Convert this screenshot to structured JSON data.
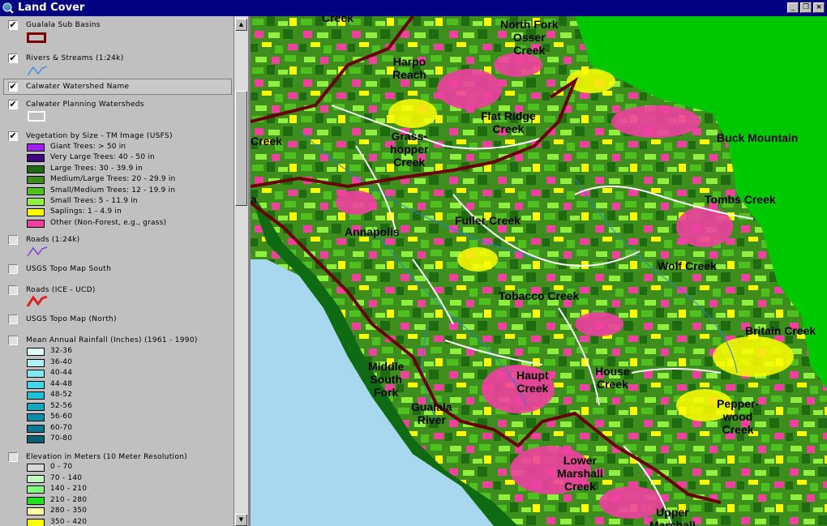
{
  "window": {
    "title": "Land Cover",
    "min_label": "_",
    "restore_label": "❐",
    "close_label": "×"
  },
  "scrollbar": {
    "up": "▲",
    "down": "▼"
  },
  "layers": {
    "sub_basins": {
      "name": "Gualala Sub Basins",
      "checked": "✔",
      "swatch_color": "#7a0000"
    },
    "rivers": {
      "name": "Rivers & Streams (1:24k)",
      "checked": "✔",
      "line_color": "#4a90e2"
    },
    "calwater_name": {
      "name": "Calwater Watershed Name",
      "checked": "✔"
    },
    "calwater_planning": {
      "name": "Calwater Planning Watersheds",
      "checked": "✔"
    },
    "vegetation": {
      "name": "Vegetation by Size - TM Image (USFS)",
      "checked": "✔",
      "classes": [
        {
          "label": "Giant Trees: > 50 in",
          "color": "#a020f0"
        },
        {
          "label": "Very Large Trees: 40 - 50 in",
          "color": "#400080"
        },
        {
          "label": "Large Trees: 30 - 39.9 in",
          "color": "#1e6b10"
        },
        {
          "label": "Medium/Large Trees: 20 - 29.9 in",
          "color": "#3c8c1c"
        },
        {
          "label": "Small/Medium Trees: 12 - 19.9 in",
          "color": "#50c020"
        },
        {
          "label": "Small Trees: 5 - 11.9 in",
          "color": "#90f040"
        },
        {
          "label": "Saplings: 1 - 4.9 in",
          "color": "#ffff00"
        },
        {
          "label": "Other (Non-Forest, e.g., grass)",
          "color": "#f040a0"
        }
      ]
    },
    "roads_24k": {
      "name": "Roads (1:24k)",
      "line_color": "#8040e0"
    },
    "topo_south": {
      "name": "USGS Topo Map South"
    },
    "roads_ice": {
      "name": "Roads (ICE - UCD)",
      "line_color": "#e02020"
    },
    "topo_north": {
      "name": "USGS Topo Map (North)"
    },
    "rainfall": {
      "name": "Mean Annual Rainfall (Inches) (1961 - 1990)",
      "classes": [
        {
          "label": "32-36",
          "color": "#e0ffff"
        },
        {
          "label": "36-40",
          "color": "#b0f0f8"
        },
        {
          "label": "40-44",
          "color": "#80e8f0"
        },
        {
          "label": "44-48",
          "color": "#40d8e8"
        },
        {
          "label": "48-52",
          "color": "#20c0d8"
        },
        {
          "label": "52-56",
          "color": "#10a8c0"
        },
        {
          "label": "56-60",
          "color": "#0890a8"
        },
        {
          "label": "60-70",
          "color": "#087890"
        },
        {
          "label": "70-80",
          "color": "#066070"
        }
      ]
    },
    "elevation": {
      "name": "Elevation in Meters (10 Meter Resolution)",
      "classes": [
        {
          "label": "0 - 70",
          "color": "#d8d8d8"
        },
        {
          "label": "70 - 140",
          "color": "#c0ffc0"
        },
        {
          "label": "140 - 210",
          "color": "#80ff80"
        },
        {
          "label": "210 - 280",
          "color": "#20e020"
        },
        {
          "label": "280 - 350",
          "color": "#ffffa0"
        },
        {
          "label": "350 - 420",
          "color": "#ffff00"
        }
      ]
    }
  },
  "map": {
    "labels": [
      {
        "text": "Creek"
      },
      {
        "text": "North Fork\nOsser\nCreek"
      },
      {
        "text": "Harpo\nReach"
      },
      {
        "text": "Flat Ridge\nCreek"
      },
      {
        "text": "Grass-\nhopper\nCreek"
      },
      {
        "text": "Creek"
      },
      {
        "text": "Buck Mountain"
      },
      {
        "text": "Tombs Creek"
      },
      {
        "text": "Fuller Creek"
      },
      {
        "text": "Annapolis"
      },
      {
        "text": "Wolf Creek"
      },
      {
        "text": "Tobacco Creek"
      },
      {
        "text": "Britain Creek"
      },
      {
        "text": "Middle\nSouth\nFork"
      },
      {
        "text": "Gualala\nRiver"
      },
      {
        "text": "Haupt\nCreek"
      },
      {
        "text": "House\nCreek"
      },
      {
        "text": "Pepper-\nwood\nCreek"
      },
      {
        "text": "Lower\nMarshall\nCreek"
      },
      {
        "text": "Upper\nMarshall"
      },
      {
        "text": "a"
      }
    ]
  }
}
